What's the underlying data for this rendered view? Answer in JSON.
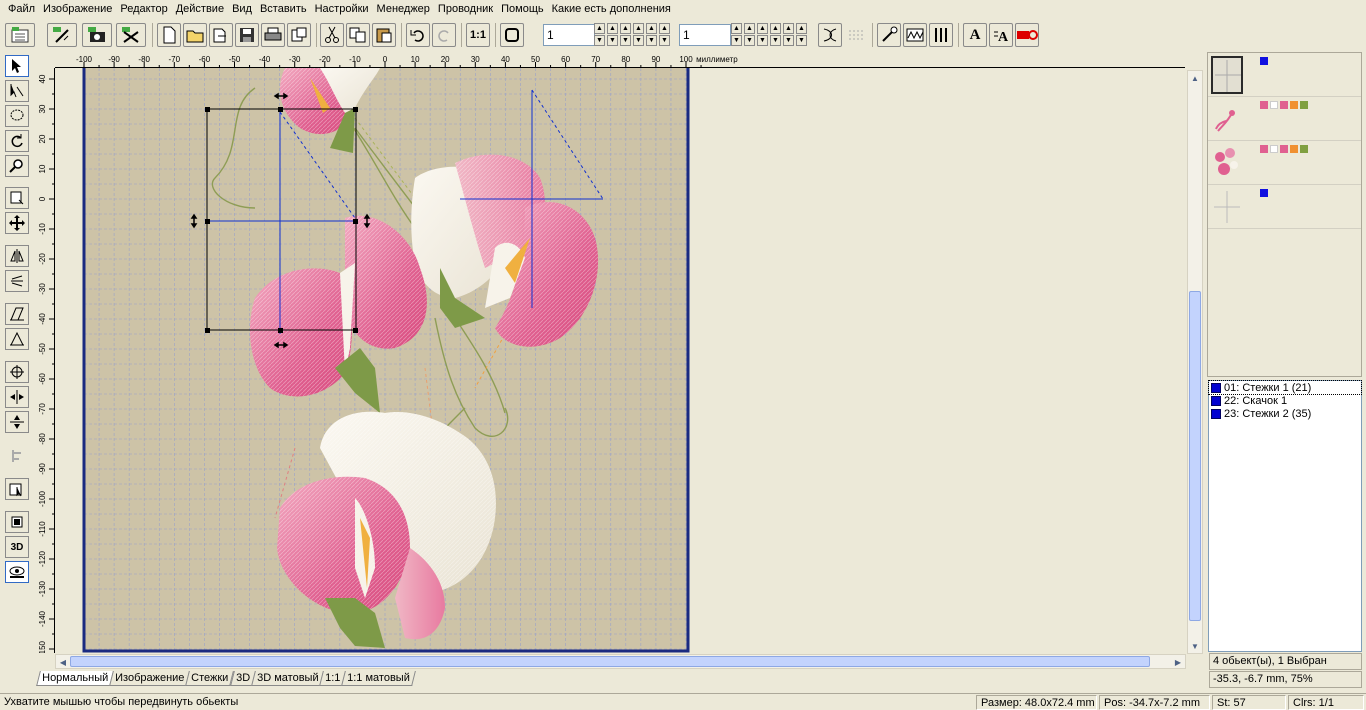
{
  "menu": [
    "Файл",
    "Изображение",
    "Редактор",
    "Действие",
    "Вид",
    "Вставить",
    "Настройки",
    "Менеджер",
    "Проводник",
    "Помощь",
    "Какие есть дополнения"
  ],
  "toolbar": {
    "value1": "1",
    "value2": "1",
    "zoom_1to1_label": "1:1",
    "text_a_label": "A"
  },
  "toolbox": {
    "label_3d": "3D"
  },
  "ruler": {
    "unit": "миллиметр",
    "x_ticks": [
      "-100",
      "-90",
      "-80",
      "-70",
      "-60",
      "-50",
      "-40",
      "-30",
      "-20",
      "-10",
      "0",
      "10",
      "20",
      "30",
      "40",
      "50",
      "60",
      "70",
      "80",
      "90",
      "100"
    ],
    "y_ticks": [
      "40",
      "30",
      "20",
      "10",
      "0",
      "-10",
      "-20",
      "-30",
      "-40",
      "-50",
      "-60",
      "-70",
      "-80",
      "-90",
      "-100",
      "-110",
      "-120",
      "-130",
      "-140",
      "-150"
    ]
  },
  "tabs": [
    "Нормальный",
    "Изображение",
    "Стежки",
    "3D",
    "3D матовый",
    "1:1",
    "1:1 матовый"
  ],
  "thumbnails": [
    {
      "swatches": [
        "#1010e0"
      ]
    },
    {
      "swatches": [
        "#e06090",
        "#ffffff",
        "#e06090",
        "#f09030",
        "#80a040"
      ]
    },
    {
      "swatches": [
        "#e06090",
        "#ffffff",
        "#e06090",
        "#f09030",
        "#80a040"
      ]
    },
    {
      "swatches": [
        "#1010e0"
      ]
    }
  ],
  "objects": [
    {
      "label": "01:  Стежки 1 (21)"
    },
    {
      "label": "22:  Скачок 1"
    },
    {
      "label": "23:  Стежки 2 (35)"
    }
  ],
  "info": {
    "count": "4 обьект(ы), 1 Выбран",
    "coords": "-35.3, -6.7 mm, 75%"
  },
  "status": {
    "hint": "Ухватите мышью чтобы передвинуть обьекты",
    "size": "Размер: 48.0x72.4 mm",
    "pos": "Pos: -34.7x-7.2 mm",
    "stitches": "St: 57",
    "colors": "Clrs: 1/1"
  },
  "colors": {
    "hoop_bg": "#cdc3a7",
    "hoop_border": "#1a2a80",
    "grid": "#9aa2c9",
    "petal_pink": "#e06090",
    "petal_white": "#f7f3ea",
    "leaf_green": "#7e9a48",
    "selection_blue": "#1030d0"
  }
}
